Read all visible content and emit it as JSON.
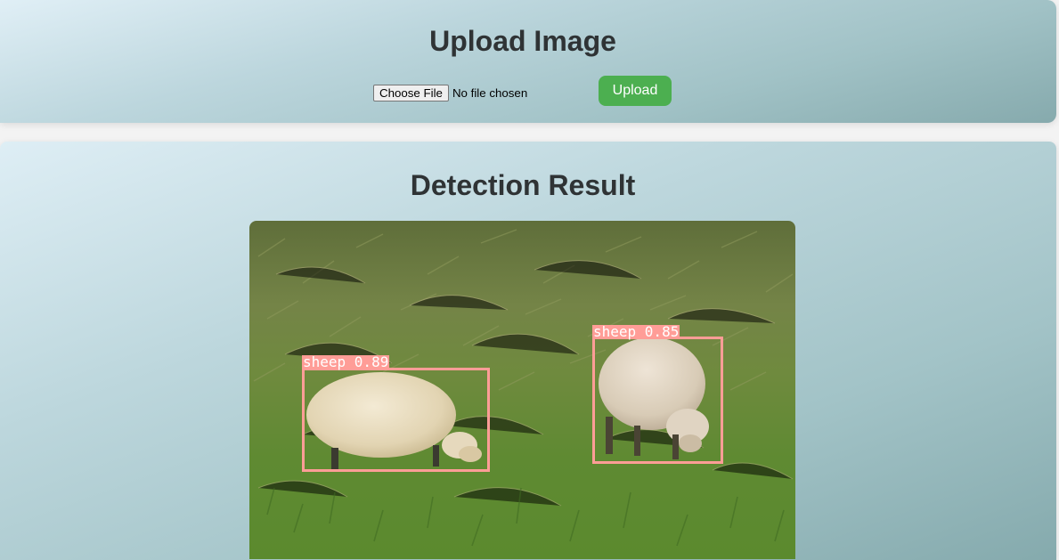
{
  "upload": {
    "title": "Upload Image",
    "choose_file_label": "Choose File",
    "file_status": "No file chosen",
    "upload_label": "Upload"
  },
  "result": {
    "title": "Detection Result",
    "detections": [
      {
        "label": "sheep 0.89"
      },
      {
        "label": "sheep 0.85"
      }
    ]
  },
  "colors": {
    "upload_button": "#4caf50",
    "box": "#ff9d97",
    "title_text": "#2f3335"
  }
}
